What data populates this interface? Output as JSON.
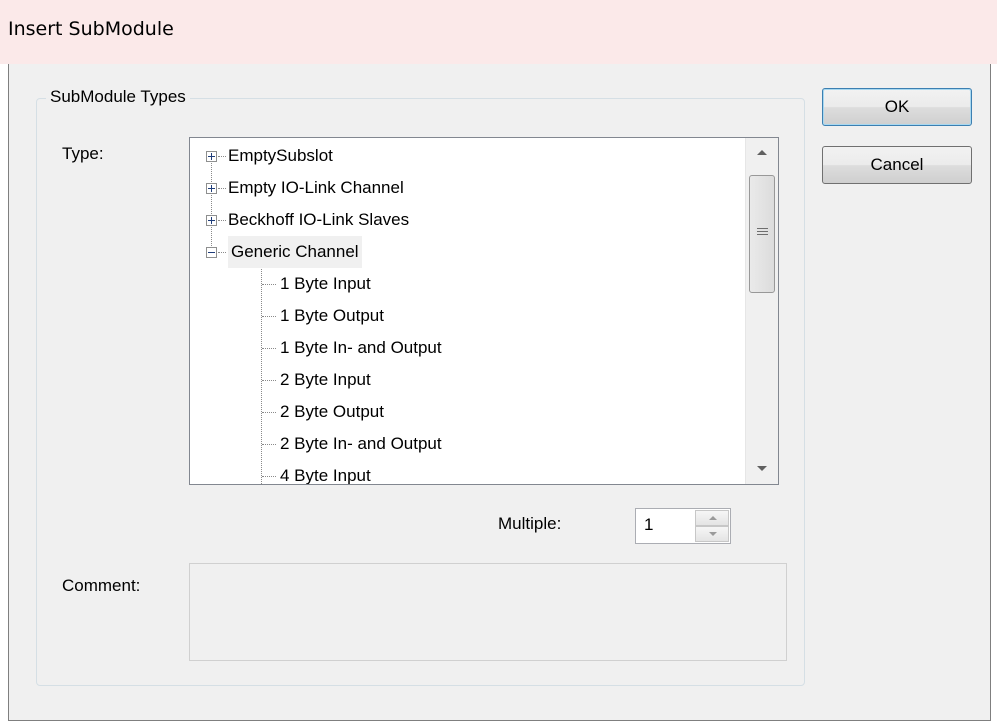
{
  "window": {
    "title": "Insert SubModule"
  },
  "group": {
    "legend": "SubModule Types"
  },
  "labels": {
    "type": "Type:",
    "multiple": "Multiple:",
    "comment": "Comment:"
  },
  "tree": {
    "items": [
      {
        "label": "EmptySubslot",
        "expander": "plus"
      },
      {
        "label": "Empty IO-Link Channel",
        "expander": "plus"
      },
      {
        "label": "Beckhoff IO-Link Slaves",
        "expander": "plus"
      },
      {
        "label": "Generic Channel",
        "expander": "minus",
        "selected": true
      },
      {
        "label": "1 Byte Input"
      },
      {
        "label": "1 Byte Output"
      },
      {
        "label": "1 Byte In- and Output"
      },
      {
        "label": "2 Byte Input"
      },
      {
        "label": "2 Byte Output"
      },
      {
        "label": "2 Byte In- and Output"
      },
      {
        "label": "4 Byte Input"
      }
    ]
  },
  "multiple": {
    "value": "1"
  },
  "comment": {
    "value": ""
  },
  "buttons": {
    "ok": "OK",
    "cancel": "Cancel"
  },
  "colors": {
    "titlebar": "#fbe9e9",
    "dialog_bg": "#f0f0f0"
  }
}
